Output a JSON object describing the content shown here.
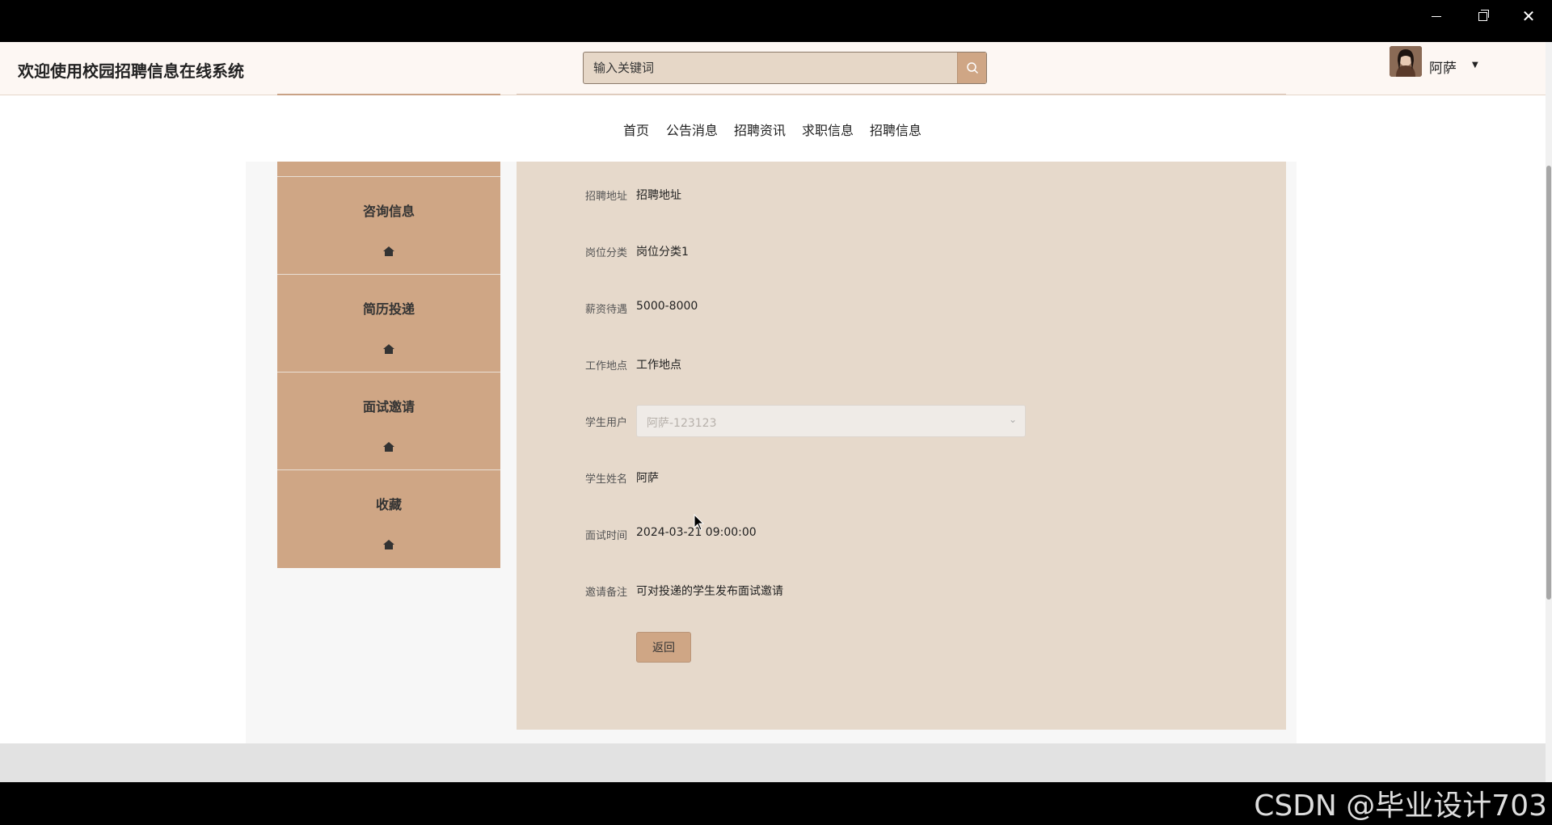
{
  "header": {
    "site_title": "欢迎使用校园招聘信息在线系统",
    "search_placeholder": "输入关键词",
    "user_name": "阿萨"
  },
  "nav": {
    "items": [
      {
        "label": "首页"
      },
      {
        "label": "公告消息"
      },
      {
        "label": "招聘资讯"
      },
      {
        "label": "求职信息"
      },
      {
        "label": "招聘信息"
      }
    ]
  },
  "sidebar": {
    "items": [
      {
        "label": "咨询信息",
        "icon": "home-icon"
      },
      {
        "label": "简历投递",
        "icon": "home-icon"
      },
      {
        "label": "面试邀请",
        "icon": "home-icon"
      },
      {
        "label": "收藏",
        "icon": "home-icon"
      }
    ]
  },
  "detail": {
    "fields": [
      {
        "label": "招聘地址",
        "value": "招聘地址"
      },
      {
        "label": "岗位分类",
        "value": "岗位分类1"
      },
      {
        "label": "薪资待遇",
        "value": "5000-8000"
      },
      {
        "label": "工作地点",
        "value": "工作地点"
      },
      {
        "label": "学生用户",
        "value": "阿萨-123123"
      },
      {
        "label": "学生姓名",
        "value": "阿萨"
      },
      {
        "label": "面试时间",
        "value": "2024-03-21 09:00:00"
      },
      {
        "label": "邀请备注",
        "value": "可对投递的学生发布面试邀请"
      }
    ],
    "back_label": "返回"
  },
  "watermark": "CSDN @毕业设计703",
  "colors": {
    "accent": "#cfa685",
    "content_bg": "#e6d9cb",
    "header_bg": "#fdf7f3"
  }
}
